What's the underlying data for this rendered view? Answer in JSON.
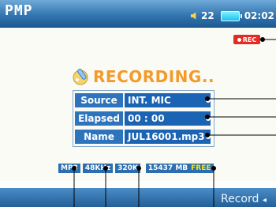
{
  "header": {
    "logo": "PMP",
    "volume": "22",
    "time": "02:02"
  },
  "status_badge": {
    "label": "REC",
    "color": "#e22c23"
  },
  "recording": {
    "title": "RECORDING.."
  },
  "info_panel": {
    "rows": [
      {
        "label": "Source",
        "value": "INT. MIC"
      },
      {
        "label": "Elapsed",
        "value": "00 : 00"
      },
      {
        "label": "Name",
        "value": "JUL16001.mp3"
      }
    ]
  },
  "info_bar": {
    "format": "MP3",
    "sample_rate": "48KHz",
    "bitrate": "320K",
    "space": "15437 MB",
    "space_status": "FREE"
  },
  "bottom": {
    "mode_label": "Record"
  },
  "colors": {
    "accent_blue": "#2c6fb1",
    "title_orange": "#f39a2c",
    "free_yellow": "#ffe400"
  }
}
